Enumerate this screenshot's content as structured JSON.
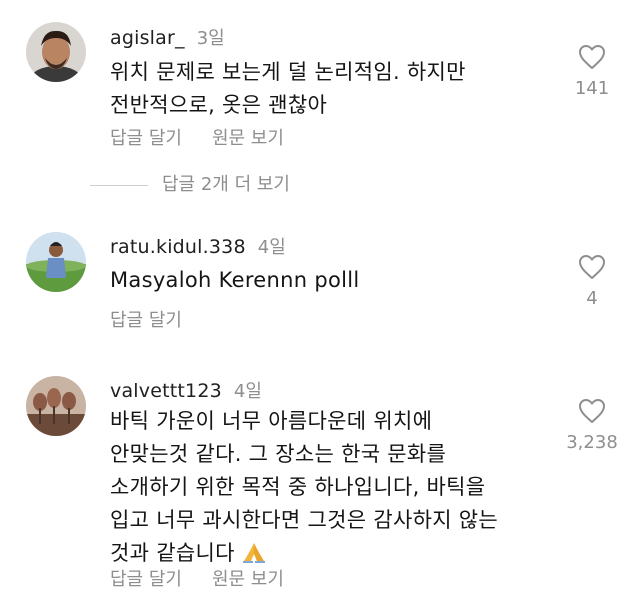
{
  "comments": [
    {
      "username": "agislar_",
      "time": "3일",
      "lines": [
        "위치 문제로 보는게 덜 논리적임. 하지만",
        "전반적으로, 옷은 괜찮아"
      ],
      "likes": "141",
      "reply_label": "답글 달기",
      "translate_label": "원문 보기"
    },
    {
      "username": "ratu.kidul.338",
      "time": "4일",
      "lines": [
        "Masyaloh Kerennn polll"
      ],
      "likes": "4",
      "reply_label": "답글 달기"
    },
    {
      "username": "valvettt123",
      "time": "4일",
      "lines": [
        "바틱 가운이 너무 아름다운데 위치에",
        "안맞는것 같다. 그 장소는 한국 문화를",
        "소개하기 위한 목적 중 하나입니다, 바틱을",
        "입고 너무 과시한다면 그것은 감사하지 않는",
        "것과 같습니다"
      ],
      "likes": "3,238",
      "reply_label": "답글 달기",
      "translate_label": "원문 보기",
      "emoji": "pray-emoji"
    }
  ],
  "view_replies": "답글 2개 더 보기",
  "icons": {
    "like": "heart-outline-icon"
  },
  "colors": {
    "secondary_text": "#8e8e8e",
    "primary_text": "#151515"
  }
}
